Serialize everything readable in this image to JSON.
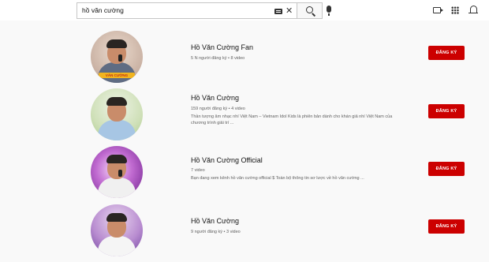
{
  "search": {
    "query": "hồ văn cường"
  },
  "icons": {
    "keyboard": "keyboard-icon",
    "clear": "close-icon",
    "search": "search-icon",
    "mic": "mic-icon",
    "create": "create-video-icon",
    "apps": "apps-grid-icon",
    "notifications": "bell-icon"
  },
  "colors": {
    "subscribe_red": "#cc0000",
    "meta_gray": "#606060"
  },
  "results": [
    {
      "name": "Hồ Văn Cường Fan",
      "meta": "5 N người đăng ký • 8 video",
      "description": "",
      "subscribe_label": "ĐĂNG KÝ",
      "avatar_caption": "VĂN CƯỜNG"
    },
    {
      "name": "Hồ Văn Cường",
      "meta": "159 người đăng ký • 4 video",
      "description": "Thần tượng âm nhạc nhí Việt Nam – Vietnam Idol Kids là phiên bản dành cho khán giả nhí Việt Nam của chương trình giải trí ...",
      "subscribe_label": "ĐĂNG KÝ"
    },
    {
      "name": "Hồ Văn Cường Official",
      "meta": "7 video",
      "description": "Bạn đang xem kênh hồ văn cường official $ Toàn bộ thông tin sơ lược về hồ văn cường ...",
      "subscribe_label": "ĐĂNG KÝ"
    },
    {
      "name": "Hồ Văn Cường",
      "meta": "9 người đăng ký • 3 video",
      "description": "",
      "subscribe_label": "ĐĂNG KÝ"
    }
  ]
}
